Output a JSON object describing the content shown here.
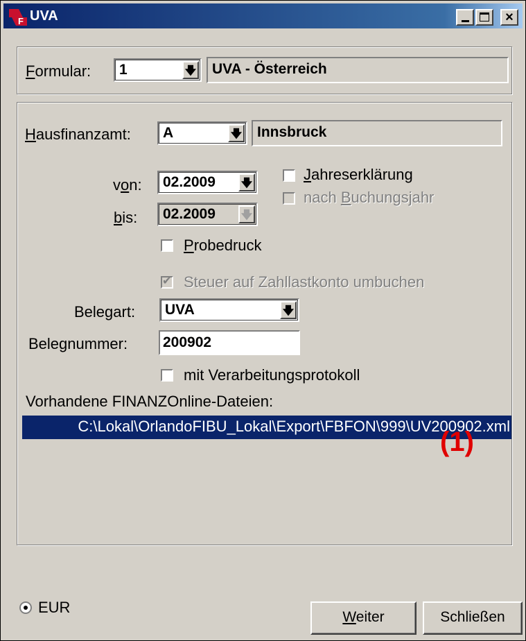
{
  "window": {
    "title": "UVA",
    "logo_letter": "F"
  },
  "formular": {
    "label_ul": "F",
    "label_rest": "ormular:",
    "value": "1",
    "description": "UVA - Österreich"
  },
  "hausfinanzamt": {
    "label_ul": "H",
    "label_rest": "ausfinanzamt:",
    "value": "A",
    "description": "Innsbruck"
  },
  "period": {
    "von_label_a": "v",
    "von_label_ul": "o",
    "von_label_b": "n:",
    "von_value": "02.2009",
    "bis_label_ul": "b",
    "bis_label_rest": "is:",
    "bis_value": "02.2009"
  },
  "options": {
    "jahreserklaerung_ul": "J",
    "jahreserklaerung_rest": "ahreserklärung",
    "nach_buchungsjahr_a": "nach ",
    "nach_buchungsjahr_ul": "B",
    "nach_buchungsjahr_b": "uchungsjahr",
    "probedruck_ul": "P",
    "probedruck_rest": "robedruck",
    "steuer": "Steuer auf Zahllastkonto umbuchen",
    "verarbeitungsprotokoll": "mit Verarbeitungsprotokoll"
  },
  "beleg": {
    "belegart_label": "Belegart:",
    "belegart_value": "UVA",
    "belegnummer_label": "Belegnummer:",
    "belegnummer_value": "200902"
  },
  "files": {
    "label": "Vorhandene FINANZOnline-Dateien:",
    "selected": "C:\\Lokal\\OrlandoFIBU_Lokal\\Export\\FBFON\\999\\UV200902.xml",
    "callout": "(1)"
  },
  "currency": {
    "label": "EUR"
  },
  "buttons": {
    "weiter_ul": "W",
    "weiter_rest": "eiter",
    "schliessen": "Schließen"
  },
  "colors": {
    "titlebar": "#0a246a",
    "selection": "#0a246a",
    "callout": "#e00000",
    "face": "#d4d0c8"
  }
}
